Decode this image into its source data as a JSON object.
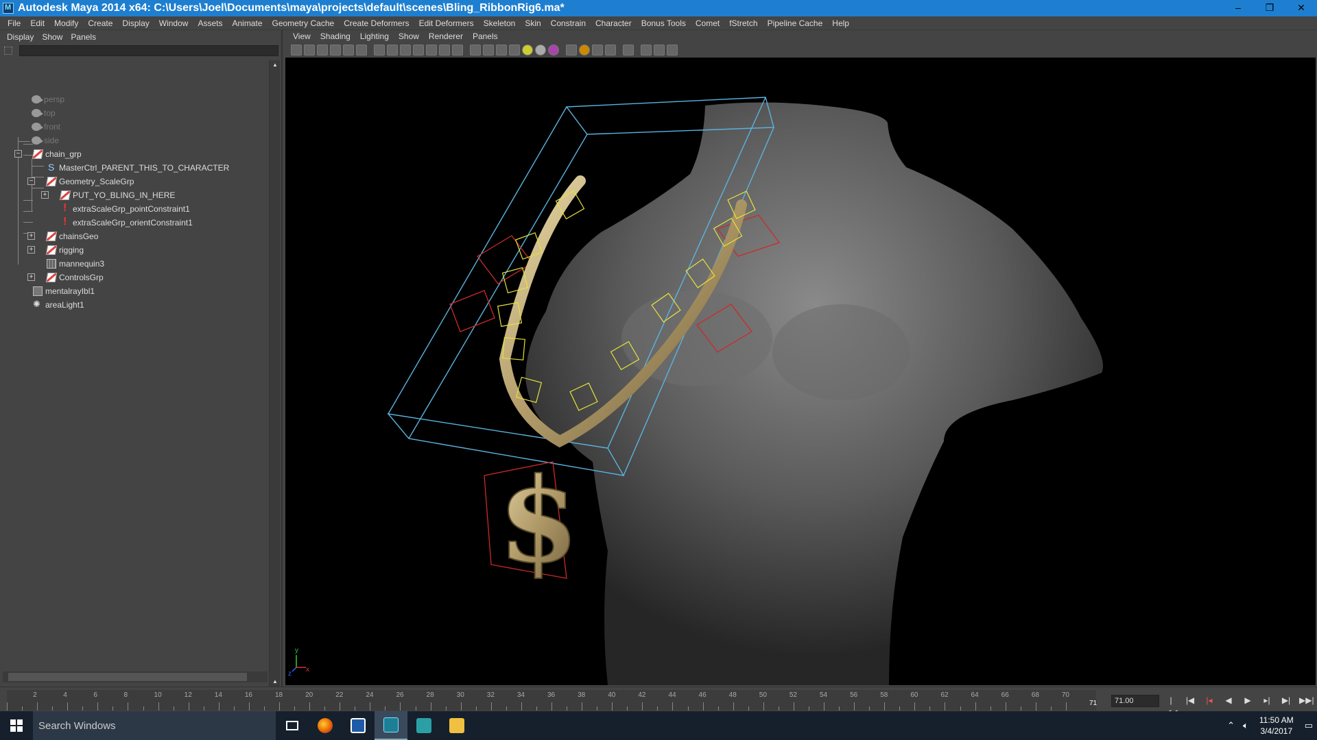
{
  "window": {
    "title": "Autodesk Maya 2014 x64: C:\\Users\\Joel\\Documents\\maya\\projects\\default\\scenes\\Bling_RibbonRig6.ma*",
    "controls": [
      "minimize-icon",
      "restore-icon",
      "close-icon"
    ]
  },
  "menubar": [
    "File",
    "Edit",
    "Modify",
    "Create",
    "Display",
    "Window",
    "Assets",
    "Animate",
    "Geometry Cache",
    "Create Deformers",
    "Edit Deformers",
    "Skeleton",
    "Skin",
    "Constrain",
    "Character",
    "Bonus Tools",
    "Comet",
    "fStretch",
    "Pipeline Cache",
    "Help"
  ],
  "outliner": {
    "menu": [
      "Display",
      "Show",
      "Panels"
    ],
    "filter_value": "",
    "nodes": [
      {
        "label": "persp",
        "icon": "camera-icon",
        "dim": true
      },
      {
        "label": "top",
        "icon": "camera-icon",
        "dim": true
      },
      {
        "label": "front",
        "icon": "camera-icon",
        "dim": true
      },
      {
        "label": "side",
        "icon": "camera-icon",
        "dim": true
      },
      {
        "label": "chain_grp",
        "icon": "group-icon",
        "expanded": true
      },
      {
        "label": "MasterCtrl_PARENT_THIS_TO_CHARACTER",
        "icon": "curve-icon"
      },
      {
        "label": "Geometry_ScaleGrp",
        "icon": "group-icon",
        "expanded": true
      },
      {
        "label": "PUT_YO_BLING_IN_HERE",
        "icon": "group-icon",
        "expanded": false
      },
      {
        "label": "extraScaleGrp_pointConstraint1",
        "icon": "constraint-icon"
      },
      {
        "label": "extraScaleGrp_orientConstraint1",
        "icon": "constraint-icon"
      },
      {
        "label": "chainsGeo",
        "icon": "group-icon",
        "expanded": false
      },
      {
        "label": "rigging",
        "icon": "group-icon",
        "expanded": false
      },
      {
        "label": "mannequin3",
        "icon": "mesh-icon"
      },
      {
        "label": "ControlsGrp",
        "icon": "group-icon",
        "expanded": false
      },
      {
        "label": "mentalrayIbl1",
        "icon": "ibl-icon"
      },
      {
        "label": "areaLight1",
        "icon": "area-light-icon"
      }
    ]
  },
  "viewport": {
    "menu": [
      "View",
      "Shading",
      "Lighting",
      "Show",
      "Renderer",
      "Panels"
    ],
    "axis": {
      "y": "y",
      "x": "x",
      "z": "z"
    }
  },
  "timeline": {
    "ticks": [
      "2",
      "4",
      "6",
      "8",
      "10",
      "12",
      "14",
      "16",
      "18",
      "20",
      "22",
      "24",
      "26",
      "28",
      "30",
      "32",
      "34",
      "36",
      "38",
      "40",
      "42",
      "44",
      "46",
      "48",
      "50",
      "52",
      "54",
      "56",
      "58",
      "60",
      "62",
      "64",
      "66",
      "68",
      "70"
    ],
    "current_frame": "71",
    "time_field": "71.00",
    "playback_controls": [
      "go-to-start-icon",
      "step-back-key-icon",
      "step-back-frame-icon",
      "play-backwards-icon",
      "play-forwards-icon",
      "step-forward-frame-icon",
      "step-forward-key-icon",
      "go-to-end-icon"
    ]
  },
  "taskbar": {
    "search_placeholder": "Search Windows",
    "time": "11:50 AM",
    "date": "3/4/2017",
    "apps": [
      "task-view-icon",
      "firefox-icon",
      "notepad-icon",
      "maya-icon",
      "maya-alt-icon",
      "file-explorer-icon"
    ]
  },
  "colors": {
    "titlebar": "#1e7fd0",
    "viewport_bg": "#000000",
    "outliner_bg": "#444444",
    "taskbar": "#16202c"
  }
}
